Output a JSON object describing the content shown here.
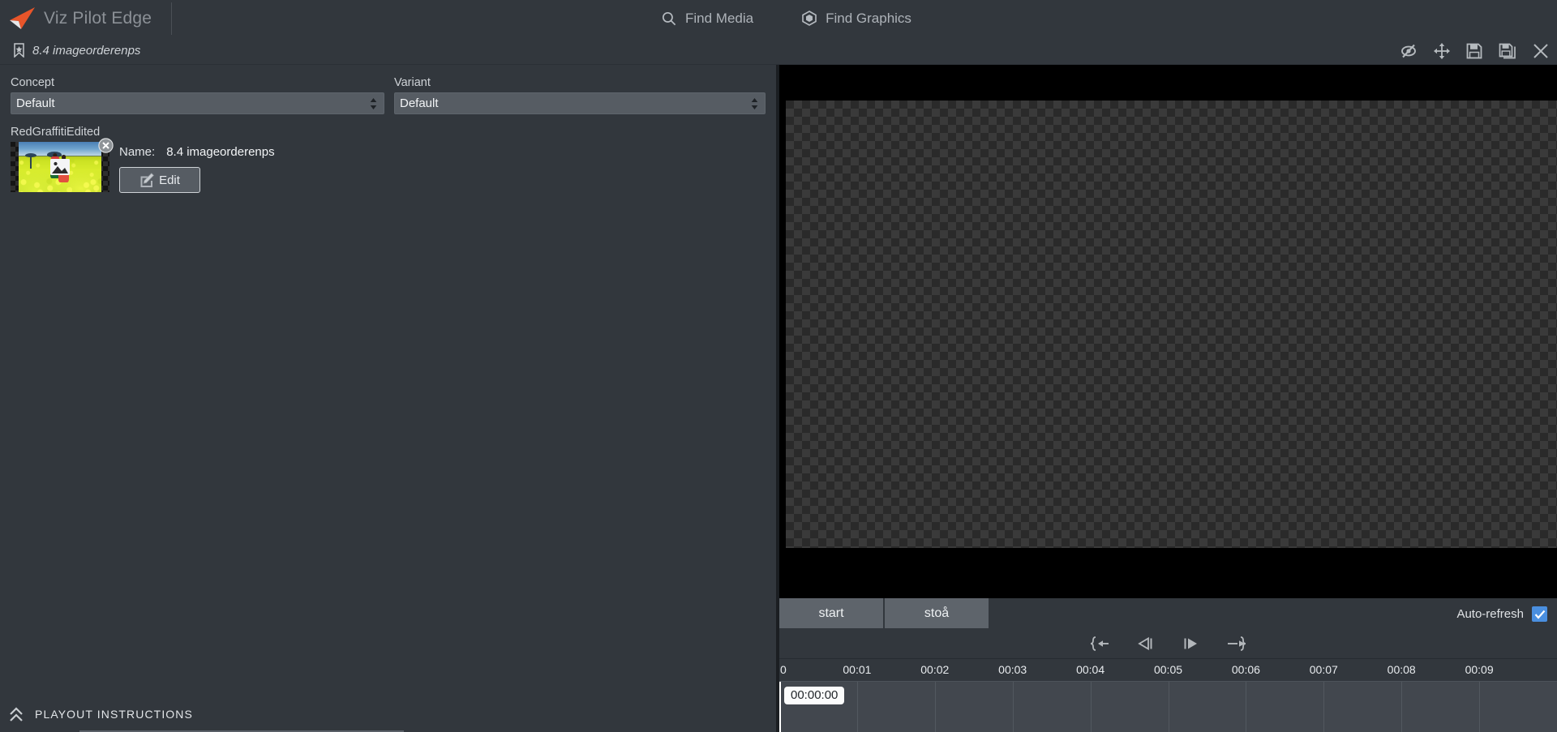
{
  "app": {
    "brand": "Viz Pilot Edge",
    "logo_icon": "arrow-logo-icon"
  },
  "topnav": {
    "items": [
      {
        "label": "Find Media",
        "icon": "search-icon"
      },
      {
        "label": "Find Graphics",
        "icon": "graphics-cube-icon"
      }
    ]
  },
  "subbar": {
    "bookmark_icon": "bookmark-star-icon",
    "doc_title": "8.4 imageorderenps",
    "tools": [
      {
        "name": "hide-preview-icon",
        "title": "eye-off"
      },
      {
        "name": "move-icon",
        "title": "move"
      },
      {
        "name": "save-icon",
        "title": "save"
      },
      {
        "name": "save-as-icon",
        "title": "save as"
      },
      {
        "name": "close-icon",
        "title": "close"
      }
    ]
  },
  "form": {
    "concept": {
      "label": "Concept",
      "value": "Default",
      "options": [
        "Default"
      ]
    },
    "variant": {
      "label": "Variant",
      "value": "Default",
      "options": [
        "Default"
      ]
    },
    "media": {
      "group_label": "RedGraffitiEdited",
      "name_label": "Name:",
      "name_value": "8.4 imageorderenps",
      "edit_label": "Edit",
      "edit_icon": "pencil-edit-icon",
      "remove_icon": "remove-circle-icon",
      "placeholder_icon": "image-placeholder-icon"
    }
  },
  "playout": {
    "label": "PLAYOUT INSTRUCTIONS",
    "toggle_icon": "chevron-double-up-icon"
  },
  "preview": {
    "alt": "Two women in green and red saris standing in a yellow mustard flower field under a blue sky with silhouetted trees"
  },
  "transport": {
    "start_label": "start",
    "stop_label": "stoå",
    "auto_refresh_label": "Auto-refresh",
    "auto_refresh_checked": true,
    "check_color": "#4a8fe0",
    "steps": [
      {
        "name": "go-to-start-icon"
      },
      {
        "name": "step-backward-icon"
      },
      {
        "name": "step-forward-icon"
      },
      {
        "name": "go-to-end-icon"
      }
    ]
  },
  "timeline": {
    "ticks": [
      "0",
      "00:01",
      "00:02",
      "00:03",
      "00:04",
      "00:05",
      "00:06",
      "00:07",
      "00:08",
      "00:09"
    ],
    "timecode": "00:00:00",
    "playhead_position": 0
  }
}
